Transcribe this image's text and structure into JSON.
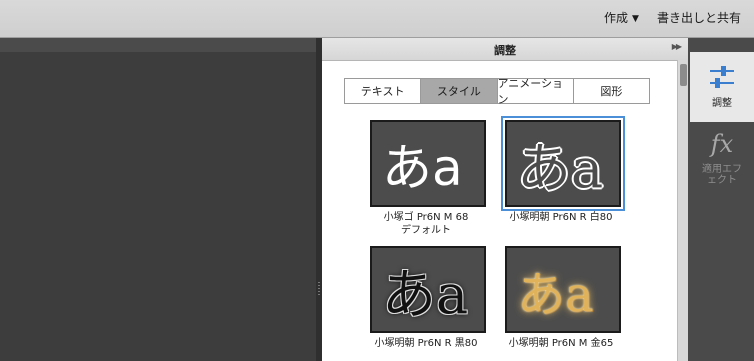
{
  "toolbar": {
    "create_label": "作成",
    "export_label": "書き出しと共有"
  },
  "panel": {
    "title": "調整",
    "menu_icon": "double-chevron-right-icon",
    "tabs": [
      {
        "label": "テキスト",
        "active": false
      },
      {
        "label": "スタイル",
        "active": true
      },
      {
        "label": "アニメーション",
        "active": false
      },
      {
        "label": "図形",
        "active": false
      }
    ],
    "styles": [
      {
        "sample": "あa",
        "name": "小塚ゴ Pr6N M 68",
        "sub": "デフォルト",
        "selected": false
      },
      {
        "sample": "あa",
        "name": "小塚明朝 Pr6N R 白80",
        "sub": "",
        "selected": true
      },
      {
        "sample": "あa",
        "name": "小塚明朝 Pr6N R 黒80",
        "sub": "",
        "selected": false
      },
      {
        "sample": "あa",
        "name": "小塚明朝 Pr6N M 金65",
        "sub": "",
        "selected": false
      }
    ]
  },
  "sidebar": {
    "items": [
      {
        "label": "調整",
        "icon": "sliders-icon",
        "active": true
      },
      {
        "label": "適用エフェクト",
        "icon_text": "fx",
        "icon": "fx-icon",
        "active": false
      }
    ]
  }
}
